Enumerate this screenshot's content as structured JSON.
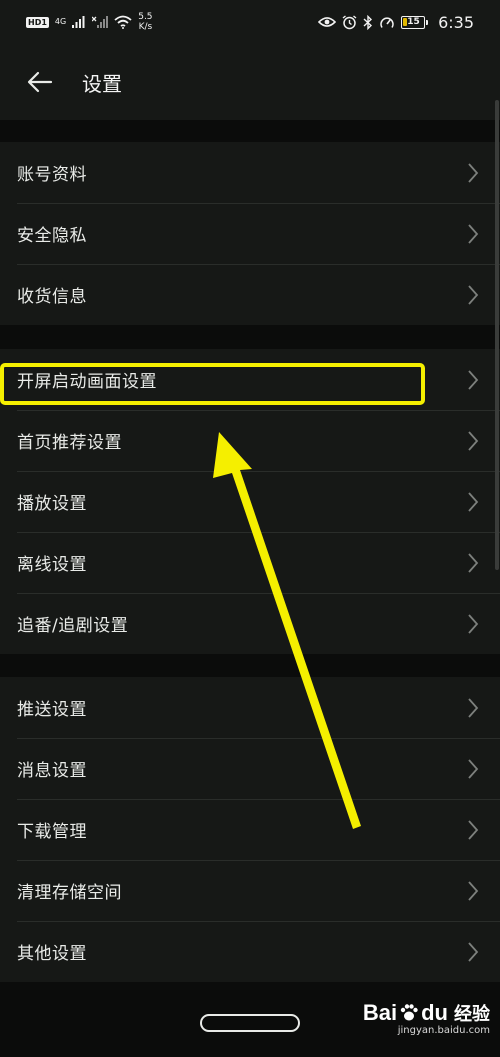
{
  "status_bar": {
    "hd": "HD",
    "sim": "1",
    "network": "4G",
    "speed_value": "5.5",
    "speed_unit": "K/s",
    "battery": "15",
    "time": "6:35"
  },
  "header": {
    "title": "设置"
  },
  "groups": [
    {
      "items": [
        "账号资料",
        "安全隐私",
        "收货信息"
      ]
    },
    {
      "items": [
        "开屏启动画面设置",
        "首页推荐设置",
        "播放设置",
        "离线设置",
        "追番/追剧设置"
      ]
    },
    {
      "items": [
        "推送设置",
        "消息设置",
        "下载管理",
        "清理存储空间",
        "其他设置"
      ]
    }
  ],
  "watermark": {
    "logo_text": "Bai",
    "logo_suffix": "du",
    "logo_cn": "经验",
    "url": "jingyan.baidu.com"
  },
  "colors": {
    "background": "#0b0c0b",
    "surface": "#161816",
    "highlight": "#f5ef00",
    "text": "#e9ebe8"
  }
}
